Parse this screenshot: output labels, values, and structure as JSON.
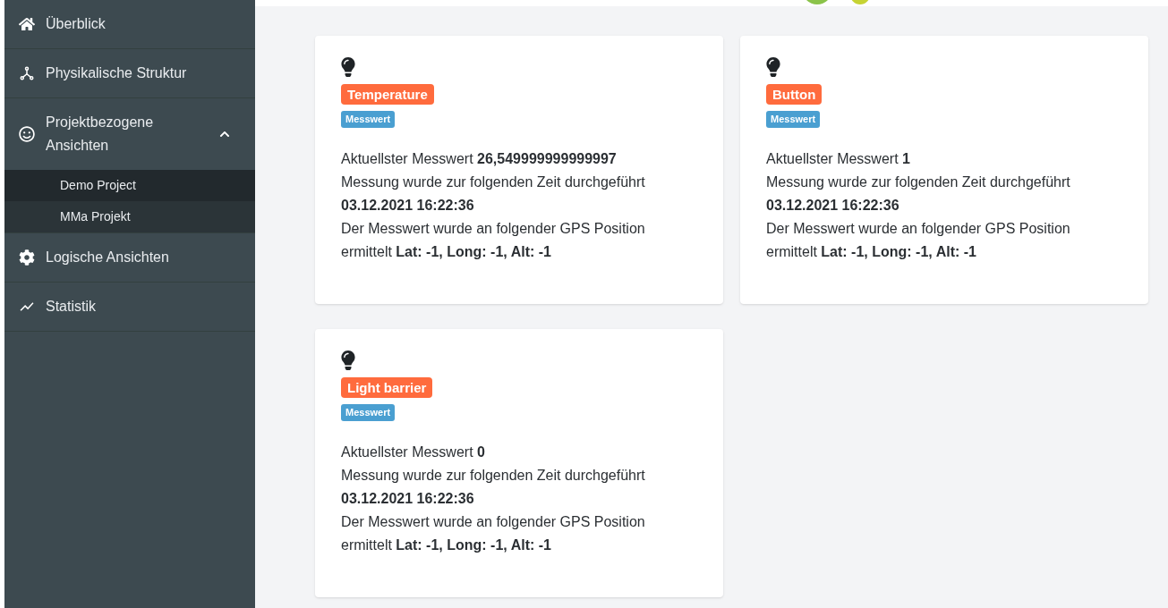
{
  "sidebar": {
    "items": [
      {
        "label": "Überblick"
      },
      {
        "label": "Physikalische Struktur"
      },
      {
        "label": "Projektbezogene Ansichten",
        "expanded": true,
        "children": [
          {
            "label": "Demo Project",
            "selected": true
          },
          {
            "label": "MMa Projekt",
            "selected": false
          }
        ]
      },
      {
        "label": "Logische Ansichten"
      },
      {
        "label": "Statistik"
      }
    ]
  },
  "cards": [
    {
      "title": "Temperature",
      "badge": "Messwert",
      "lines": [
        "Aktuellster Messwert **26,549999999999997**",
        "Messung wurde zur folgenden Zeit durchgeführt",
        "**03.12.2021 16:22:36**",
        "Der Messwert wurde an folgender GPS Position ermittelt **Lat: -1, Long: -1, Alt: -1**"
      ]
    },
    {
      "title": "Button",
      "badge": "Messwert",
      "lines": [
        "Aktuellster Messwert **1**",
        "Messung wurde zur folgenden Zeit durchgeführt",
        "**03.12.2021 16:22:36**",
        "Der Messwert wurde an folgender GPS Position ermittelt **Lat: -1, Long: -1, Alt: -1**"
      ]
    },
    {
      "title": "Light barrier",
      "badge": "Messwert",
      "lines": [
        "Aktuellster Messwert **0**",
        "Messung wurde zur folgenden Zeit durchgeführt",
        "**03.12.2021 16:22:36**",
        "Der Messwert wurde an folgender GPS Position ermittelt **Lat: -1, Long: -1, Alt: -1**"
      ]
    }
  ]
}
